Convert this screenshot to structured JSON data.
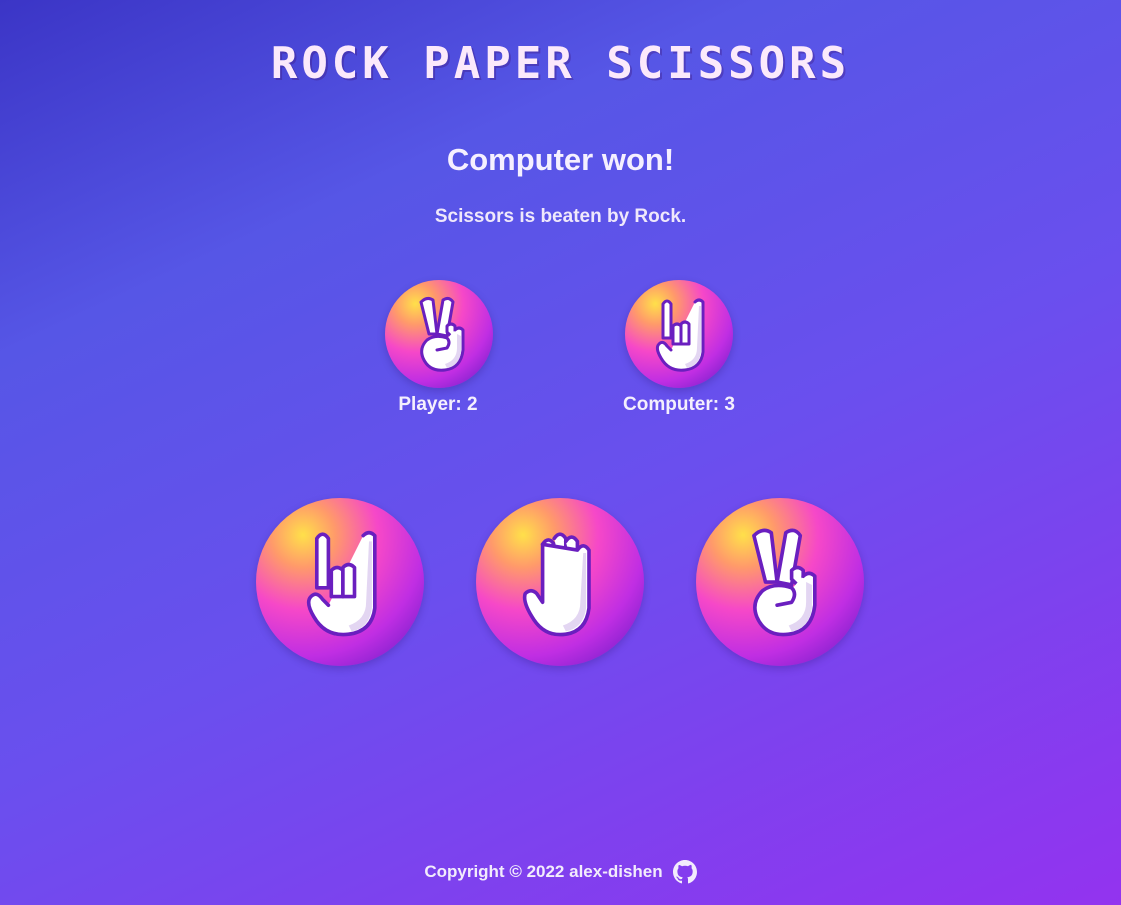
{
  "title": "ROCK PAPER SCISSORS",
  "result": {
    "heading": "Computer won!",
    "detail": "Scissors is beaten by Rock."
  },
  "player": {
    "choice_icon": "scissors-hand-icon",
    "score_label": "Player: 2"
  },
  "computer": {
    "choice_icon": "rock-hand-icon",
    "score_label": "Computer: 3"
  },
  "choices": [
    {
      "name": "rock",
      "icon": "rock-hand-icon"
    },
    {
      "name": "paper",
      "icon": "paper-hand-icon"
    },
    {
      "name": "scissors",
      "icon": "scissors-hand-icon"
    }
  ],
  "footer": {
    "copyright": "Copyright © 2022 alex-dishen",
    "link_icon": "github-icon"
  },
  "colors": {
    "accent_yellow": "#ffe04a",
    "accent_pink": "#f648c8",
    "accent_purple": "#5a18c0",
    "hand_outline": "#6a1fbf"
  }
}
